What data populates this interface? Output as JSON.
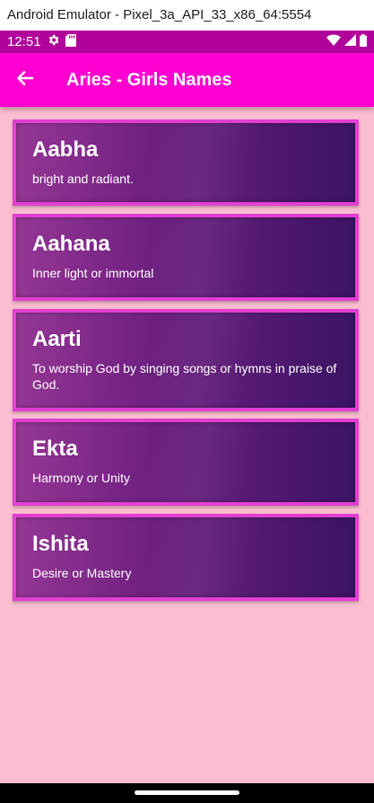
{
  "window": {
    "title": "Android Emulator - Pixel_3a_API_33_x86_64:5554"
  },
  "status_bar": {
    "time": "12:51",
    "icons": [
      "gear-icon",
      "sd-card-icon",
      "wifi-icon",
      "signal-icon",
      "battery-icon"
    ]
  },
  "app_bar": {
    "back_icon": "arrow-left-icon",
    "title": "Aries - Girls Names"
  },
  "names": [
    {
      "name": "Aabha",
      "meaning": "bright and radiant."
    },
    {
      "name": "Aahana",
      "meaning": "Inner light or immortal"
    },
    {
      "name": "Aarti",
      "meaning": "To worship God by singing songs or hymns in praise of God."
    },
    {
      "name": "Ekta",
      "meaning": "Harmony or Unity"
    },
    {
      "name": "Ishita",
      "meaning": "Desire or Mastery"
    }
  ],
  "colors": {
    "background": "#fbbdd0",
    "status_bar": "#b0009a",
    "app_bar": "#ff00d0",
    "card_border": "#e23fd2",
    "card_gradient_start": "#8e2a8e",
    "card_gradient_end": "#3b1363"
  }
}
